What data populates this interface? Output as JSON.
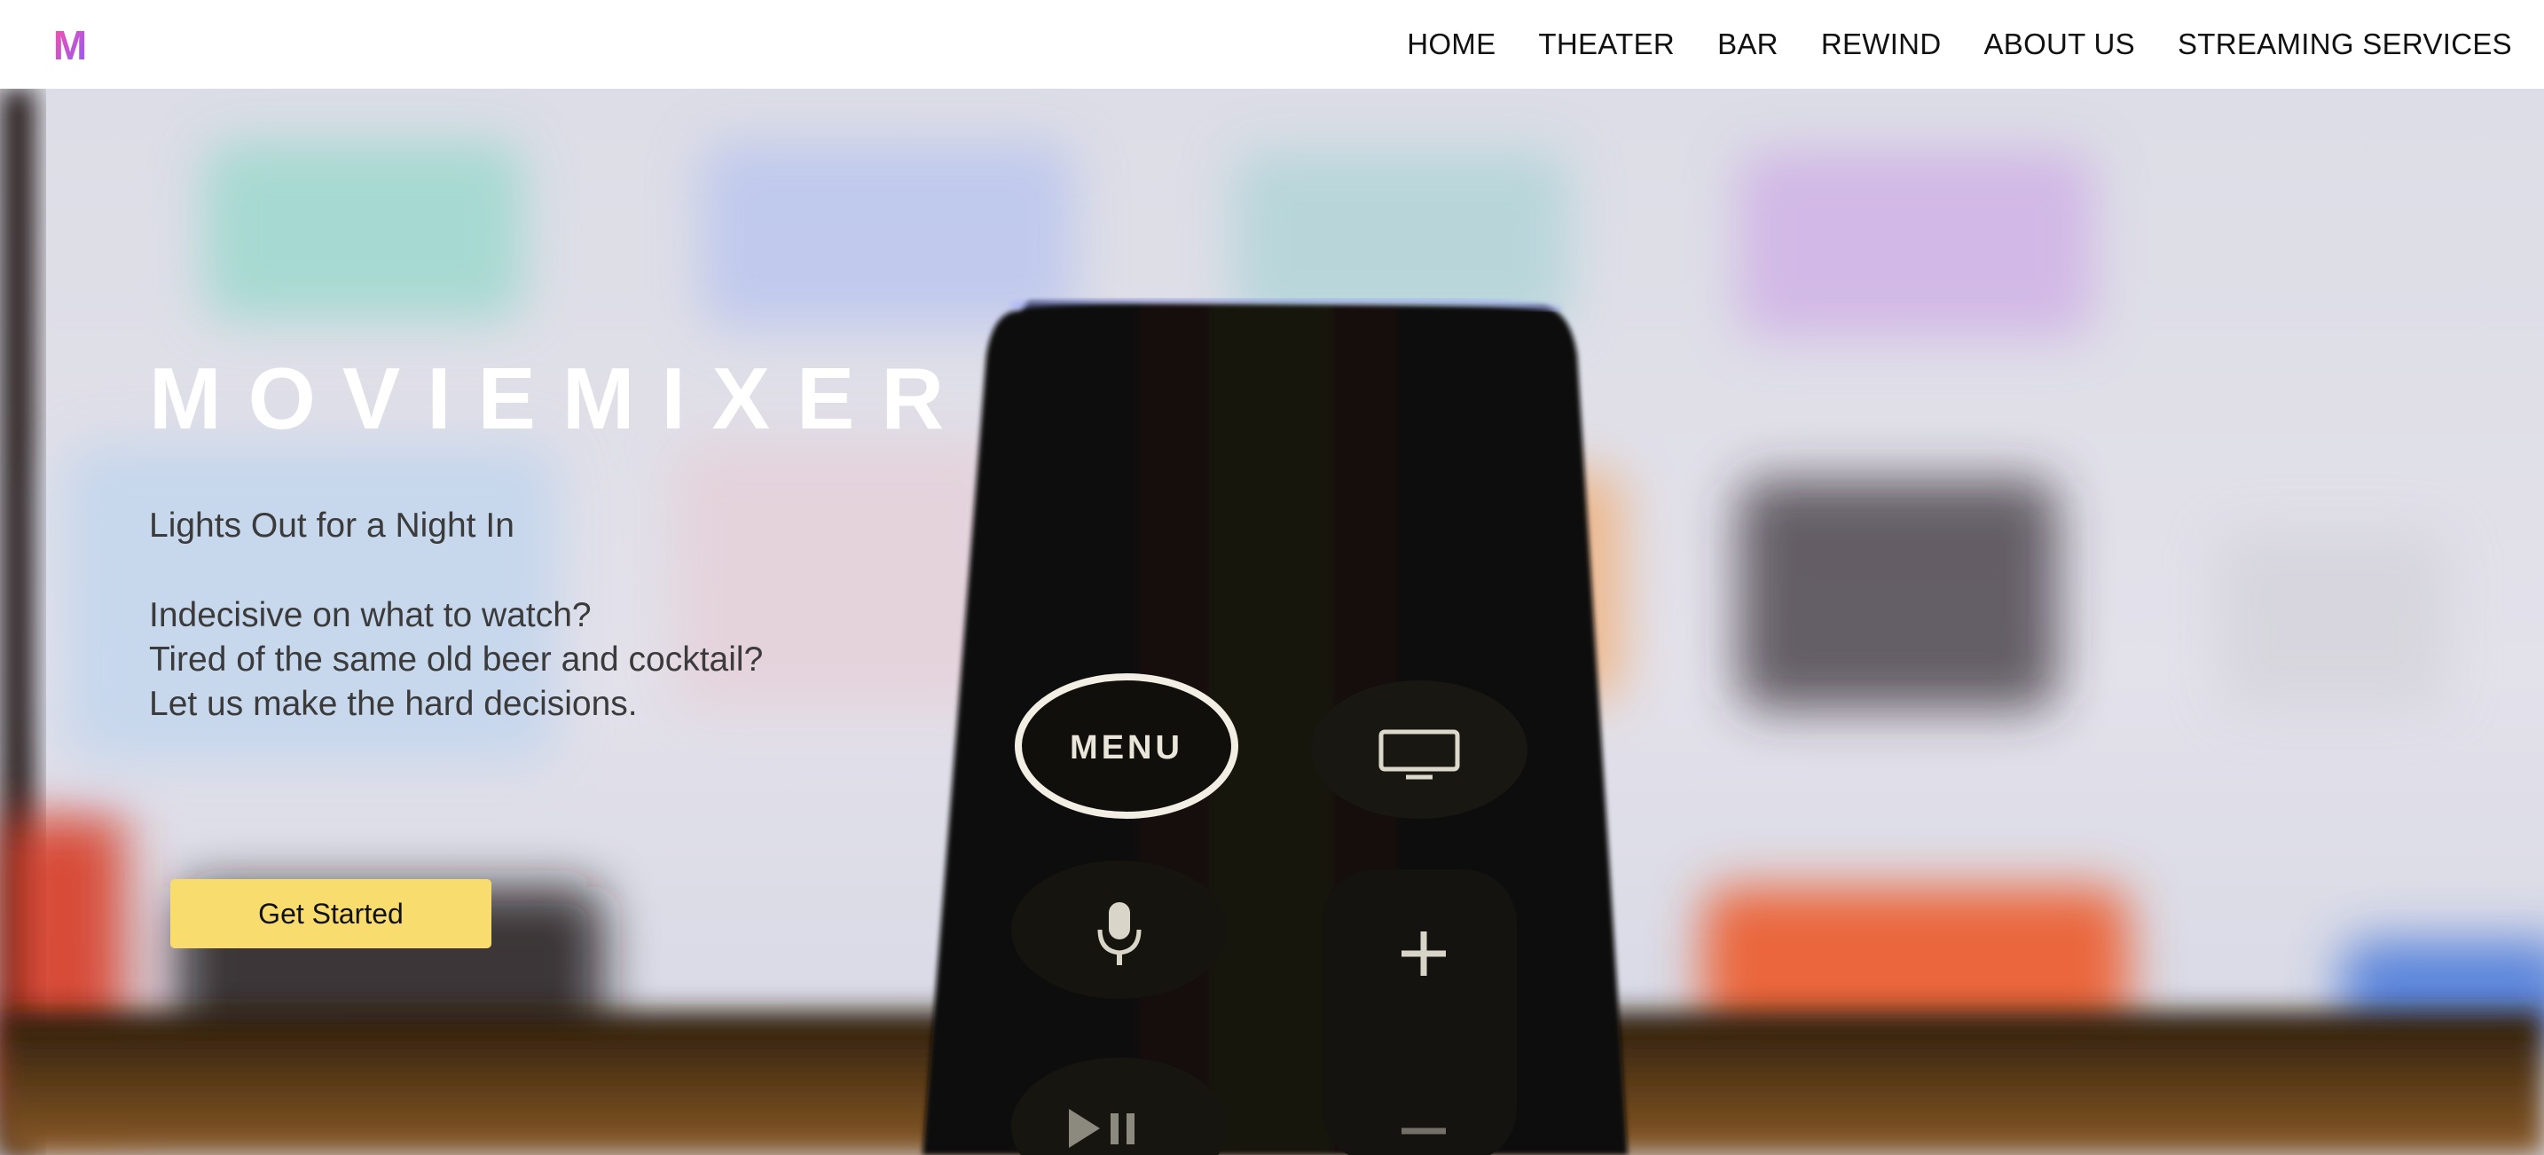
{
  "brand": {
    "logo_letter": "M",
    "logo_colors": [
      "#ff4fa3",
      "#8a5cff"
    ]
  },
  "nav": {
    "items": [
      {
        "label": "HOME"
      },
      {
        "label": "THEATER"
      },
      {
        "label": "BAR"
      },
      {
        "label": "REWIND"
      },
      {
        "label": "ABOUT US"
      },
      {
        "label": "STREAMING SERVICES"
      }
    ]
  },
  "hero": {
    "title": "MOVIEMIXER",
    "tagline": "Lights Out for a Night In",
    "copy_lines": [
      "Indecisive on what to watch?",
      "Tired of the same old beer and cocktail?",
      "Let us make the hard decisions."
    ],
    "cta_label": "Get Started",
    "remote": {
      "menu_label": "MENU"
    }
  },
  "colors": {
    "cta_background": "#f9dc6e",
    "nav_background": "#ffffff",
    "body_text": "#3b3b3b"
  }
}
